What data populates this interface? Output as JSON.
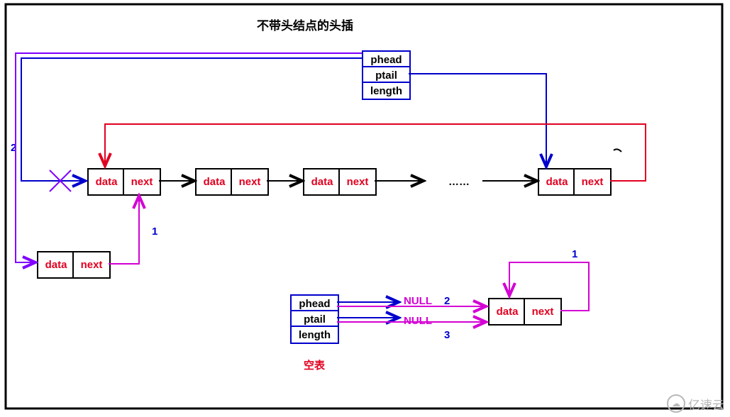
{
  "title": "不带头结点的头插",
  "struct_top": {
    "f1": "phead",
    "f2": "ptail",
    "f3": "length"
  },
  "struct_bottom": {
    "f1": "phead",
    "f2": "ptail",
    "f3": "length"
  },
  "node": {
    "data": "data",
    "next": "next"
  },
  "labels": {
    "ellipsis": "……",
    "null1": "NULL",
    "null2": "NULL",
    "empty_table": "空表",
    "marker_top_2": "2",
    "marker_mid_1": "1",
    "marker_bot_1": "1",
    "marker_bot_2": "2",
    "marker_bot_3": "3"
  },
  "watermark": "亿速云"
}
